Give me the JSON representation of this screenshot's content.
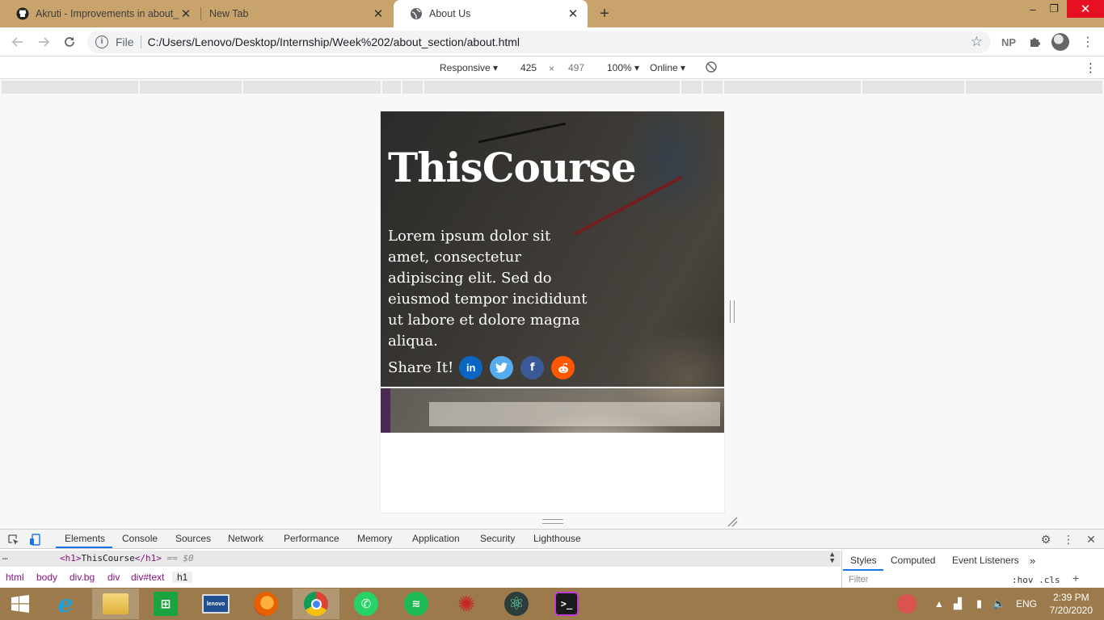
{
  "browser": {
    "tabs": [
      {
        "title": "Akruti - Improvements in about_",
        "favicon": "github-icon",
        "active": false
      },
      {
        "title": "New Tab",
        "favicon": "none",
        "active": false
      },
      {
        "title": "About Us",
        "favicon": "globe-icon",
        "active": true
      }
    ],
    "new_tab_symbol": "+",
    "window_controls": {
      "minimize": "–",
      "restore": "❐",
      "close": "✕"
    },
    "address": {
      "scheme_label": "File",
      "url": "C:/Users/Lenovo/Desktop/Internship/Week%202/about_section/about.html"
    },
    "profile_initials": "NP"
  },
  "device_toolbar": {
    "mode": "Responsive",
    "width": "425",
    "times": "×",
    "height": "497",
    "zoom": "100%",
    "network": "Online"
  },
  "page": {
    "title": "ThisCourse",
    "body": "Lorem ipsum dolor sit amet, consectetur adipiscing elit. Sed do eiusmod tempor incididunt ut labore et dolore magna aliqua.",
    "share_label": "Share It!",
    "social_buttons": [
      {
        "name": "linkedin",
        "glyph": "in",
        "color": "#0a66c2"
      },
      {
        "name": "twitter",
        "glyph": "🐦",
        "color": "#55acee"
      },
      {
        "name": "facebook",
        "glyph": "f",
        "color": "#3b5998"
      },
      {
        "name": "reddit",
        "glyph": "☻",
        "color": "#ff5700"
      }
    ]
  },
  "devtools": {
    "tabs": [
      "Elements",
      "Console",
      "Sources",
      "Network",
      "Performance",
      "Memory",
      "Application",
      "Security",
      "Lighthouse"
    ],
    "active_tab": "Elements",
    "dom_line": {
      "open": "<h1>",
      "text": "ThisCourse",
      "close": "</h1>",
      "suffix": "== $0"
    },
    "breadcrumbs": [
      "html",
      "body",
      "div.bg",
      "div",
      "div#text",
      "h1"
    ],
    "side_tabs": [
      "Styles",
      "Computed",
      "Event Listeners"
    ],
    "filter_placeholder": "Filter",
    "hov_cls": ":hov .cls"
  },
  "taskbar": {
    "apps": [
      "start",
      "internet-explorer",
      "file-explorer",
      "store",
      "lenovo",
      "firefox",
      "chrome",
      "whatsapp",
      "spotify",
      "spider-app",
      "atom",
      "terminal"
    ],
    "language": "ENG",
    "time": "2:39 PM",
    "date": "7/20/2020"
  }
}
